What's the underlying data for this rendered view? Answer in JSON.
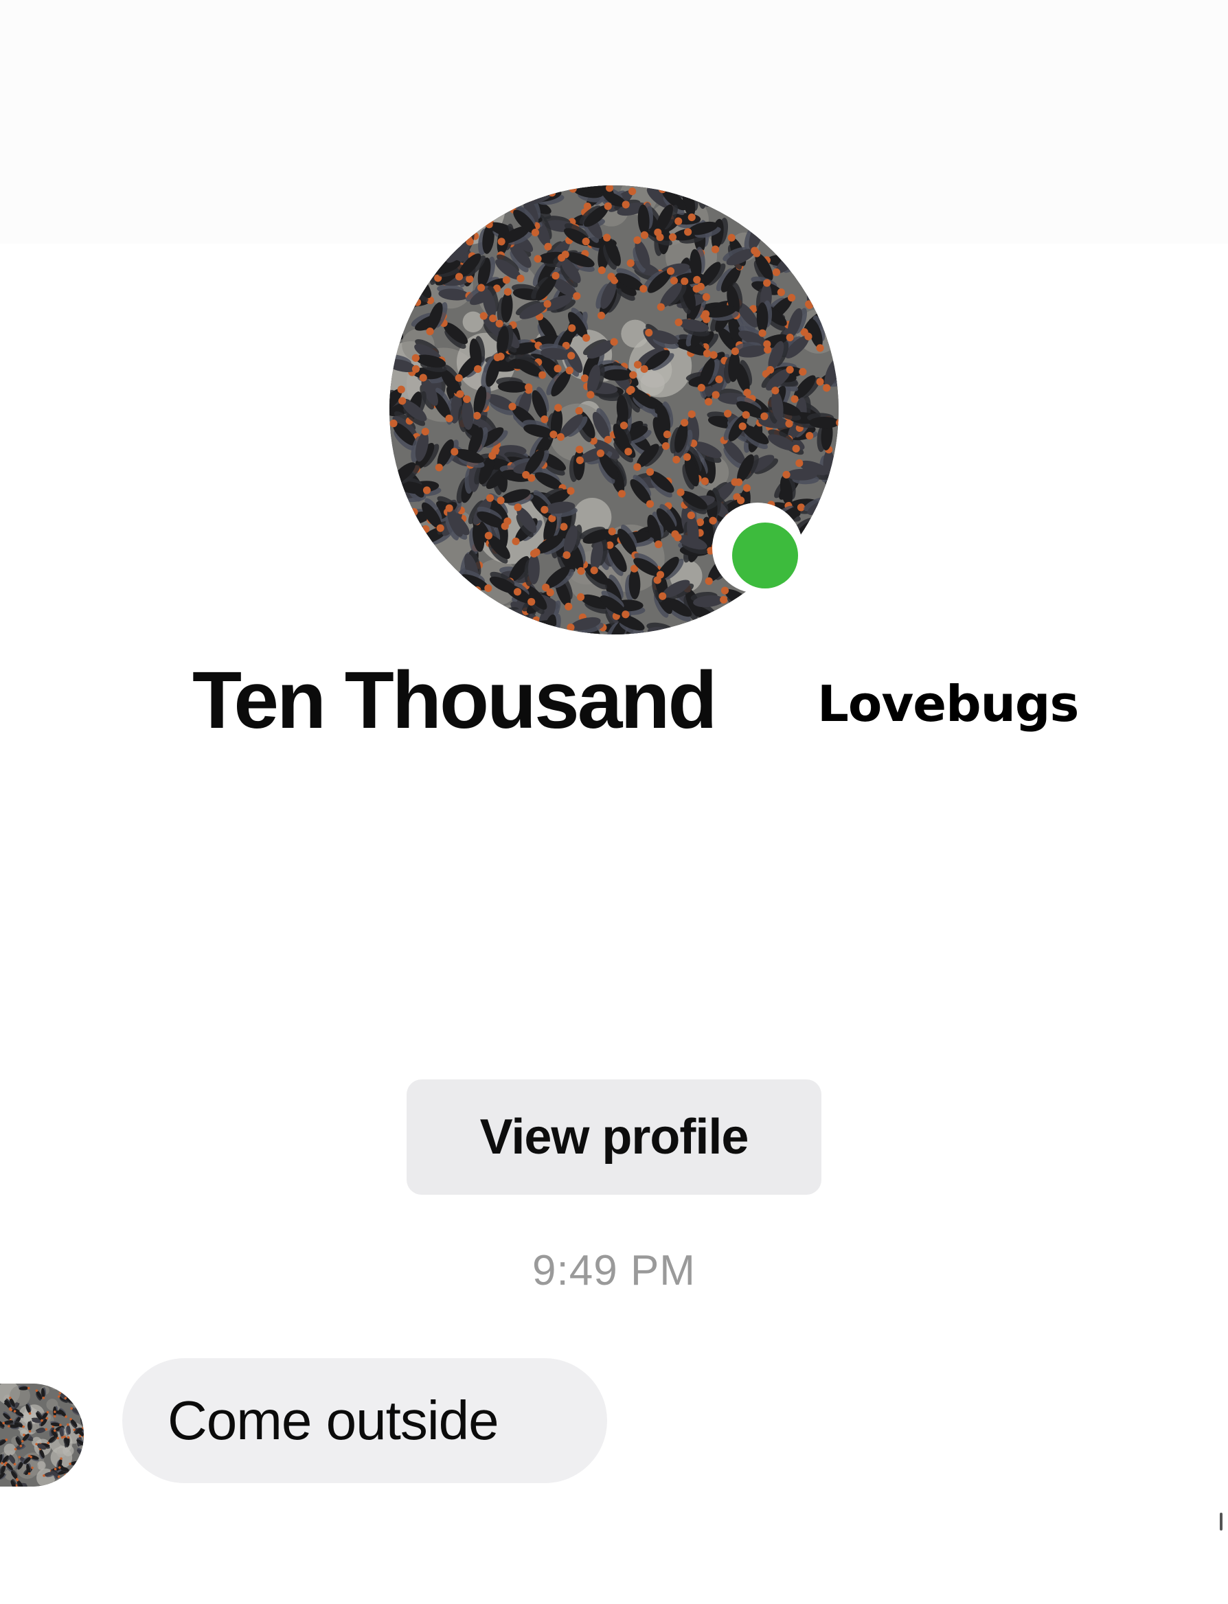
{
  "contact": {
    "first_name_part": "Ten Thousand",
    "second_name_part": "Lovebugs",
    "online_status_color": "#3dbb3d"
  },
  "profile": {
    "avatar_icon": "lovebug-swarm-photo",
    "view_profile_label": "View profile"
  },
  "conversation": {
    "timestamp": "9:49 PM",
    "messages": [
      {
        "sender": "contact",
        "text": "Come outside",
        "avatar_icon": "lovebug-swarm-photo"
      }
    ]
  },
  "colors": {
    "bubble_background": "#efeff1",
    "button_background": "#ebebed",
    "timestamp_text": "#9a9a9a",
    "name_text": "#0b0b0b"
  }
}
